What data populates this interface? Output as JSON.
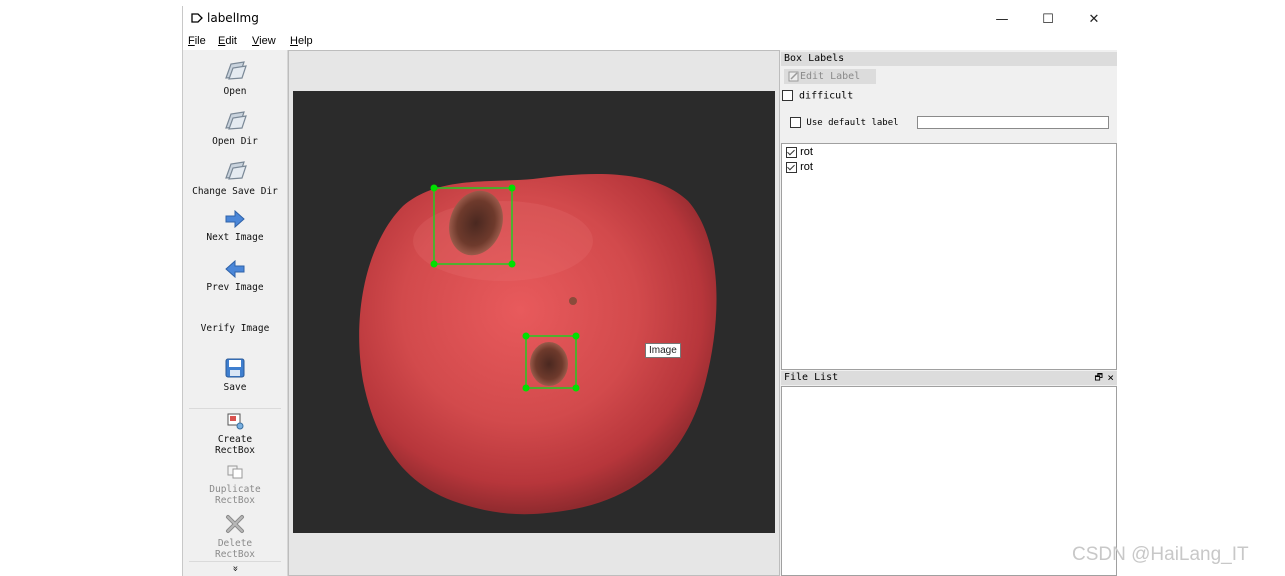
{
  "window": {
    "title": "labelImg",
    "controls": {
      "minimize": "—",
      "maximize": "☐",
      "close": "✕"
    }
  },
  "menu": [
    {
      "accel": "F",
      "rest": "ile"
    },
    {
      "accel": "E",
      "rest": "dit"
    },
    {
      "accel": "V",
      "rest": "iew"
    },
    {
      "accel": "H",
      "rest": "elp"
    }
  ],
  "toolbar": {
    "open": "Open",
    "open_dir": "Open Dir",
    "change_save_dir": "Change Save Dir",
    "next_image": "Next Image",
    "prev_image": "Prev Image",
    "verify_image": "Verify Image",
    "save": "Save",
    "create_rectbox": [
      "Create",
      "RectBox"
    ],
    "duplicate_rectbox": [
      "Duplicate",
      "RectBox"
    ],
    "delete_rectbox": [
      "Delete",
      "RectBox"
    ],
    "more": "»"
  },
  "canvas": {
    "tooltip": "Image"
  },
  "box_labels": {
    "title": "Box Labels",
    "edit_label": "Edit Label",
    "difficult": "difficult",
    "use_default_label": "Use default label",
    "default_label_value": "",
    "labels": [
      {
        "text": "rot",
        "checked": true
      },
      {
        "text": "rot",
        "checked": true
      }
    ]
  },
  "file_list": {
    "title": "File List",
    "float_icon": "🗗",
    "close_icon": "×"
  },
  "watermark": "CSDN @HaiLang_IT",
  "colors": {
    "box": "#22cc22",
    "handle": "#00e000"
  }
}
